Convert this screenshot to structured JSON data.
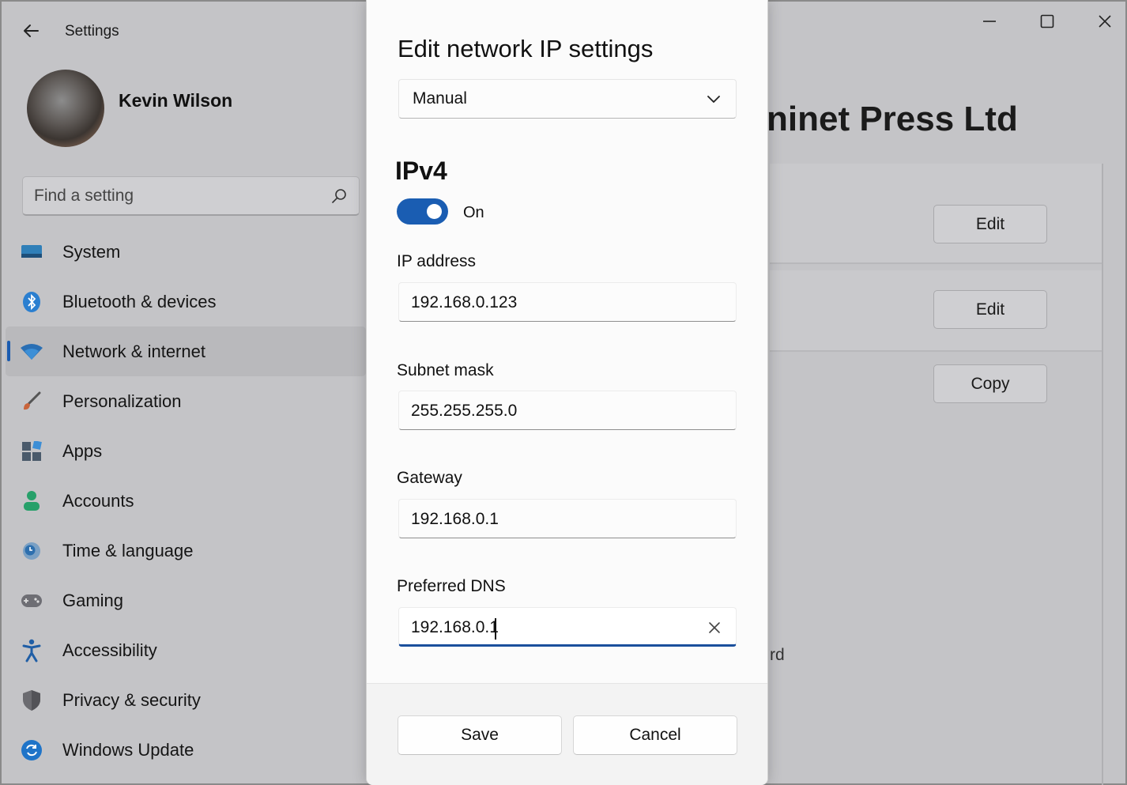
{
  "window": {
    "title": "Settings",
    "user_name": "Kevin Wilson"
  },
  "search": {
    "placeholder": "Find a setting"
  },
  "sidebar": {
    "items": [
      {
        "label": "System",
        "icon": "monitor-icon"
      },
      {
        "label": "Bluetooth & devices",
        "icon": "bluetooth-icon"
      },
      {
        "label": "Network & internet",
        "icon": "wifi-icon",
        "active": true
      },
      {
        "label": "Personalization",
        "icon": "paintbrush-icon"
      },
      {
        "label": "Apps",
        "icon": "apps-icon"
      },
      {
        "label": "Accounts",
        "icon": "person-icon"
      },
      {
        "label": "Time & language",
        "icon": "globe-clock-icon"
      },
      {
        "label": "Gaming",
        "icon": "gamepad-icon"
      },
      {
        "label": "Accessibility",
        "icon": "accessibility-icon"
      },
      {
        "label": "Privacy & security",
        "icon": "shield-icon"
      },
      {
        "label": "Windows Update",
        "icon": "update-icon"
      }
    ]
  },
  "background": {
    "heading": "ninet Press Ltd",
    "buttons": [
      "Edit",
      "Edit",
      "Copy"
    ],
    "snippet": "rd"
  },
  "dialog": {
    "title": "Edit network IP settings",
    "mode_selected": "Manual",
    "section": "IPv4",
    "toggle_label": "On",
    "toggle_on": true,
    "fields": [
      {
        "label": "IP address",
        "value": "192.168.0.123"
      },
      {
        "label": "Subnet mask",
        "value": "255.255.255.0"
      },
      {
        "label": "Gateway",
        "value": "192.168.0.1"
      },
      {
        "label": "Preferred DNS",
        "value": "192.168.0.1"
      }
    ],
    "save_label": "Save",
    "cancel_label": "Cancel"
  },
  "colors": {
    "accent": "#1a5db2",
    "focus_underline": "#1a4f9c",
    "dim_background": "#c4c4c7"
  }
}
